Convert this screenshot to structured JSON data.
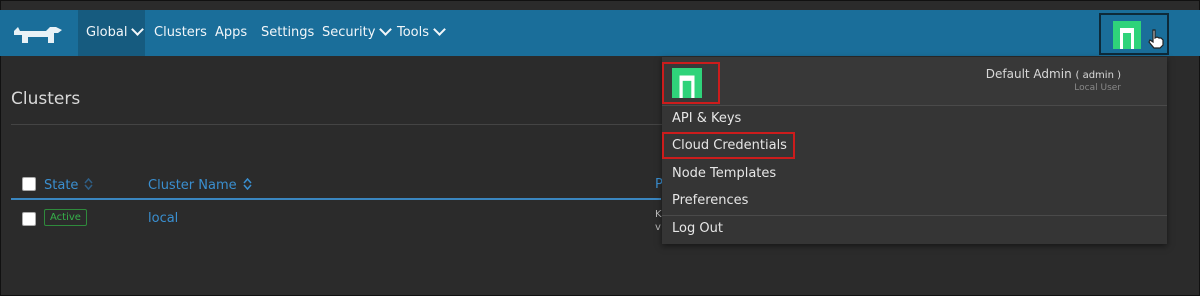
{
  "colors": {
    "nav": "#1a6e9a",
    "nav_active": "#165b7f",
    "link": "#3a8fd0",
    "active_badge": "#36b24a",
    "highlight": "#cc1c1c",
    "avatar_green": "#2fd37a"
  },
  "nav": {
    "logo_icon": "rancher-logo-icon",
    "items": [
      {
        "label": "Global",
        "dropdown": true
      },
      {
        "label": "Clusters",
        "dropdown": false
      },
      {
        "label": "Apps",
        "dropdown": false
      },
      {
        "label": "Settings",
        "dropdown": false
      },
      {
        "label": "Security",
        "dropdown": true
      },
      {
        "label": "Tools",
        "dropdown": true
      }
    ],
    "avatar_icon": "user-avatar-icon",
    "cursor_icon": "hand-pointer-icon"
  },
  "page": {
    "title": "Clusters",
    "table": {
      "headers": [
        "State",
        "Cluster Name",
        "P"
      ],
      "rows": [
        {
          "state": "Active",
          "name": "local",
          "cut_1": "K",
          "cut_2": "v"
        }
      ]
    }
  },
  "user_menu": {
    "user_name": "Default Admin",
    "user_id": "( admin )",
    "user_type": "Local User",
    "items": [
      "API & Keys",
      "Cloud Credentials",
      "Node Templates",
      "Preferences",
      "Log Out"
    ],
    "highlighted": [
      "avatar",
      "Cloud Credentials"
    ]
  }
}
